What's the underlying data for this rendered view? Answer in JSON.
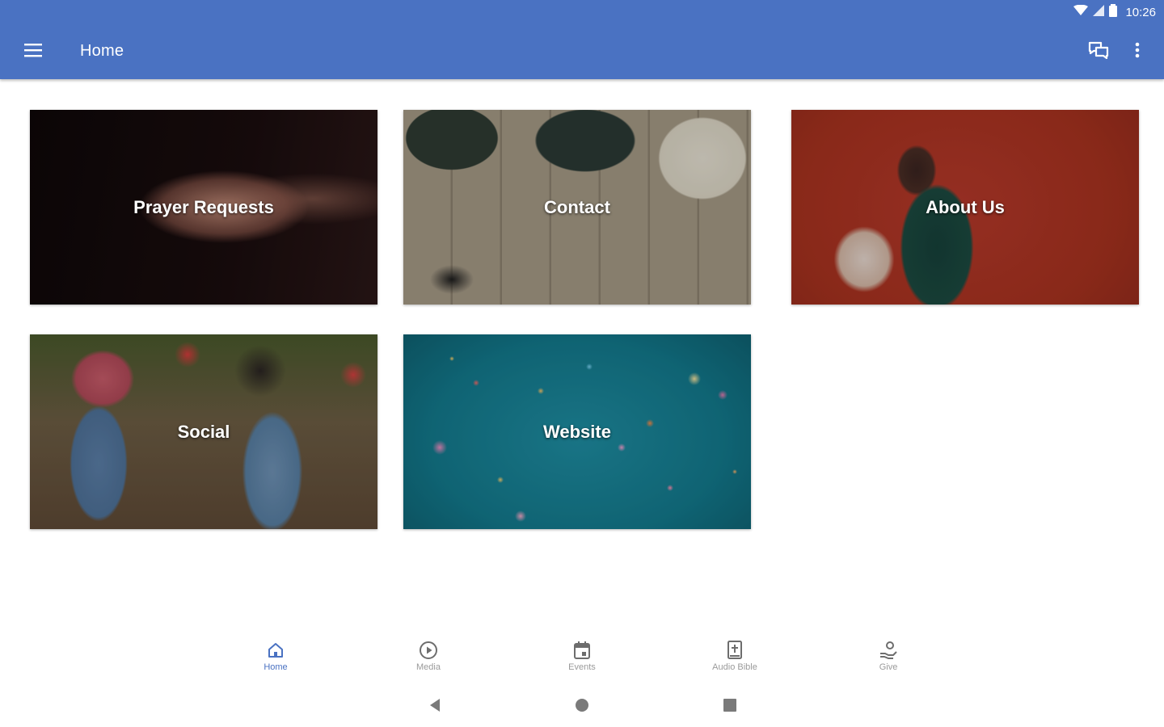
{
  "status_bar": {
    "time": "10:26"
  },
  "app_bar": {
    "title": "Home",
    "background_color": "#4a72c2"
  },
  "tiles": [
    {
      "label": "Prayer Requests"
    },
    {
      "label": "Contact"
    },
    {
      "label": "About Us"
    },
    {
      "label": "Social"
    },
    {
      "label": "Website"
    }
  ],
  "bottom_nav": {
    "active_color": "#4a72c2",
    "items": [
      {
        "label": "Home",
        "icon": "home-icon",
        "active": true
      },
      {
        "label": "Media",
        "icon": "play-circle-icon",
        "active": false
      },
      {
        "label": "Events",
        "icon": "calendar-icon",
        "active": false
      },
      {
        "label": "Audio Bible",
        "icon": "bible-icon",
        "active": false
      },
      {
        "label": "Give",
        "icon": "give-hand-icon",
        "active": false
      }
    ]
  },
  "system_nav": {
    "icons": [
      "back-icon",
      "home-circle-icon",
      "recents-icon"
    ]
  }
}
